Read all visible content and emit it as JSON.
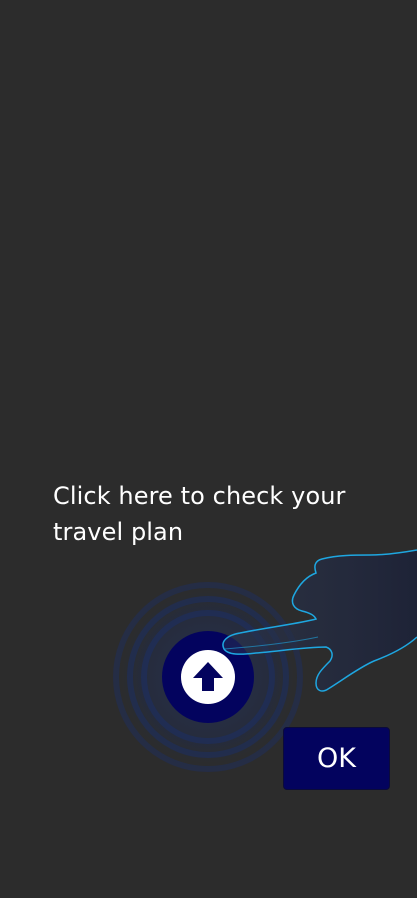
{
  "tutorial": {
    "hint_text": "Click here to check your travel plan",
    "ok_label": "OK",
    "target_icon": "arrow-up-icon",
    "pointer_icon": "pointing-hand-icon"
  },
  "colors": {
    "background": "#2c2c2c",
    "button": "#03035e",
    "glow": "#1b2a55",
    "hand_outline": "#1ea7e1"
  }
}
